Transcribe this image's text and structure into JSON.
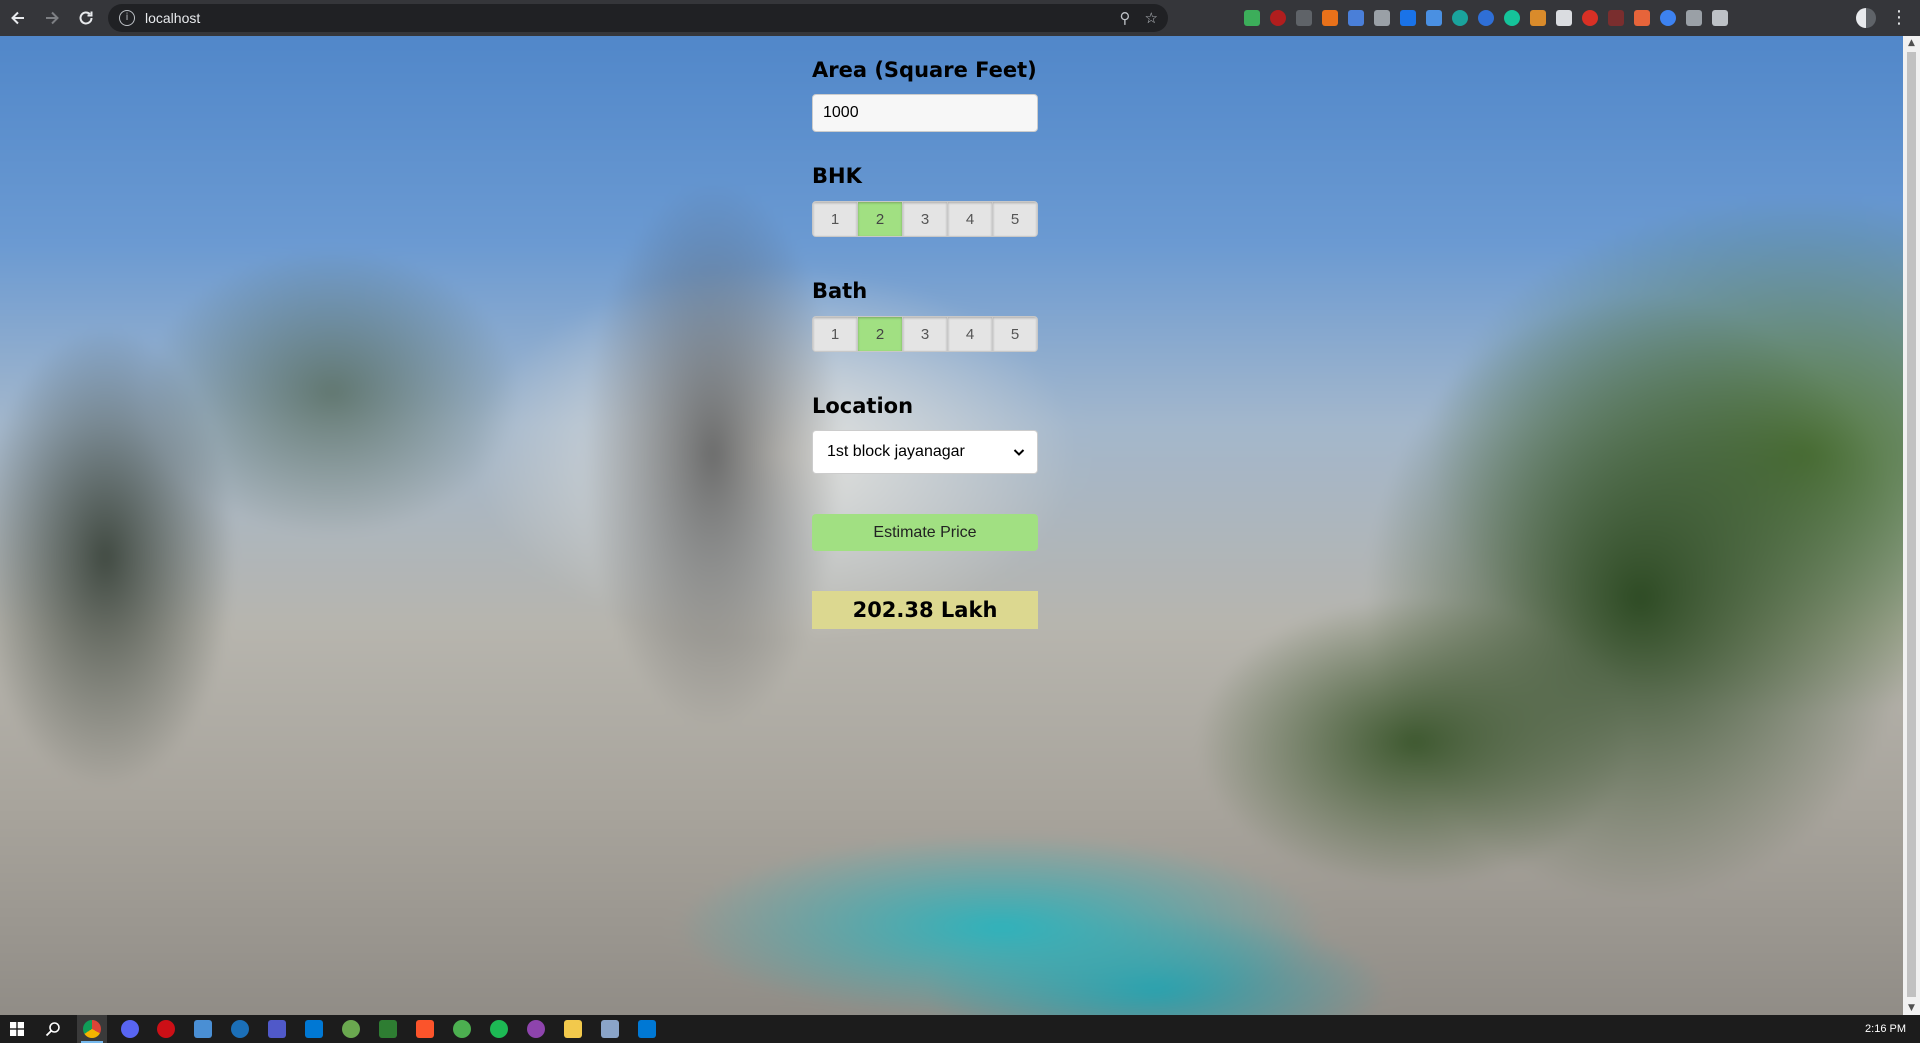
{
  "browser": {
    "url": "localhost",
    "icons": [
      "back-arrow-icon",
      "forward-arrow-icon",
      "reload-icon",
      "info-icon",
      "zoom-icon",
      "bookmark-star-icon",
      "extensions-puzzle-icon",
      "reading-list-icon",
      "profile-avatar-icon",
      "kebab-menu-icon"
    ]
  },
  "form": {
    "area_label": "Area (Square Feet)",
    "area_value": "1000",
    "bhk_label": "BHK",
    "bhk_options": [
      "1",
      "2",
      "3",
      "4",
      "5"
    ],
    "bhk_selected": "2",
    "bath_label": "Bath",
    "bath_options": [
      "1",
      "2",
      "3",
      "4",
      "5"
    ],
    "bath_selected": "2",
    "location_label": "Location",
    "location_selected": "1st block jayanagar",
    "estimate_button": "Estimate Price",
    "result": "202.38 Lakh"
  },
  "colors": {
    "accent_green": "#a1e082",
    "result_yellow": "#dcd890",
    "chrome_dark": "#35363a",
    "taskbar": "#1c1c1c"
  },
  "taskbar": {
    "clock": "2:16 PM"
  }
}
